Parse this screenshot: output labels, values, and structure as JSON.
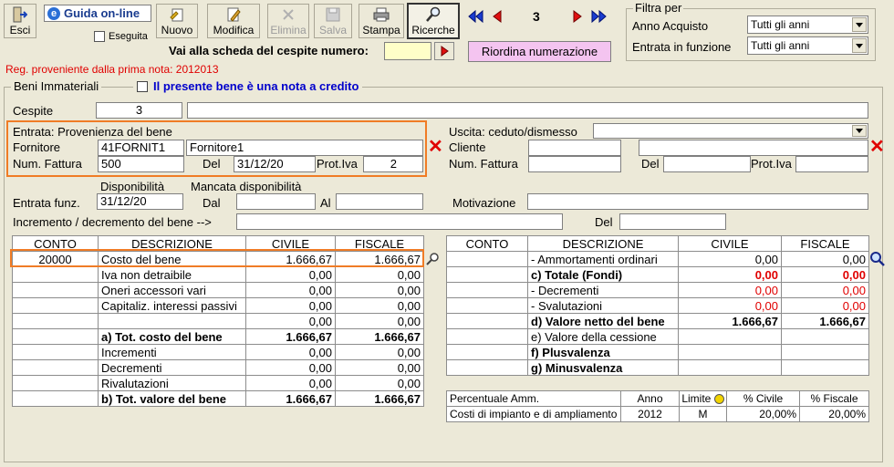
{
  "toolbar": {
    "esci": "Esci",
    "guida": "Guida on-line",
    "eseguita": "Eseguita",
    "nuovo": "Nuovo",
    "modifica": "Modifica",
    "elimina": "Elimina",
    "salva": "Salva",
    "stampa": "Stampa",
    "ricerche": "Ricerche",
    "record_number": "3"
  },
  "vai_label": "Vai alla scheda del cespite numero:",
  "riordina": "Riordina numerazione",
  "filtra": {
    "title": "Filtra per",
    "anno_label": "Anno Acquisto",
    "anno_value": "Tutti gli anni",
    "entrata_label": "Entrata in funzione",
    "entrata_value": "Tutti gli anni"
  },
  "reg_note": "Reg. proveniente dalla prima nota: 2012013",
  "section_title": "Beni Immateriali",
  "nota_credito": "Il presente bene è una nota a credito",
  "cespite": {
    "label": "Cespite",
    "value": "3",
    "desc": ""
  },
  "entrata": {
    "title": "Entrata: Provenienza del bene",
    "fornitore_label": "Fornitore",
    "fornitore_code": "41FORNIT1",
    "fornitore_name": "Fornitore1",
    "num_fattura_label": "Num. Fattura",
    "num_fattura": "500",
    "del_label": "Del",
    "del_value": "31/12/20",
    "prot_label": "Prot.Iva",
    "prot_value": "2"
  },
  "uscita": {
    "title": "Uscita: ceduto/dismesso",
    "cliente_label": "Cliente",
    "num_fattura_label": "Num. Fattura",
    "del_label": "Del",
    "prot_label": "Prot.Iva"
  },
  "disp": {
    "disponibilita": "Disponibilità",
    "mancata": "Mancata disponibilità",
    "entrata_funz_label": "Entrata funz.",
    "entrata_funz": "31/12/20",
    "dal_label": "Dal",
    "al_label": "Al",
    "motivazione_label": "Motivazione",
    "incremento_label": "Incremento / decremento del bene -->",
    "del_label": "Del"
  },
  "left_table": {
    "headers": [
      "CONTO",
      "DESCRIZIONE",
      "CIVILE",
      "FISCALE"
    ],
    "rows": [
      {
        "conto": "20000",
        "desc": "Costo del bene",
        "civile": "1.666,67",
        "fiscale": "1.666,67",
        "bold": false
      },
      {
        "conto": "",
        "desc": "Iva non detraibile",
        "civile": "0,00",
        "fiscale": "0,00",
        "bold": false
      },
      {
        "conto": "",
        "desc": "Oneri accessori vari",
        "civile": "0,00",
        "fiscale": "0,00",
        "bold": false
      },
      {
        "conto": "",
        "desc": "Capitaliz. interessi passivi",
        "civile": "0,00",
        "fiscale": "0,00",
        "bold": false
      },
      {
        "conto": "",
        "desc": "",
        "civile": "0,00",
        "fiscale": "0,00",
        "bold": false
      },
      {
        "conto": "",
        "desc": "a) Tot. costo del bene",
        "civile": "1.666,67",
        "fiscale": "1.666,67",
        "bold": true
      },
      {
        "conto": "",
        "desc": "Incrementi",
        "civile": "0,00",
        "fiscale": "0,00",
        "bold": false
      },
      {
        "conto": "",
        "desc": "Decrementi",
        "civile": "0,00",
        "fiscale": "0,00",
        "bold": false
      },
      {
        "conto": "",
        "desc": "Rivalutazioni",
        "civile": "0,00",
        "fiscale": "0,00",
        "bold": false
      },
      {
        "conto": "",
        "desc": "b) Tot. valore del bene",
        "civile": "1.666,67",
        "fiscale": "1.666,67",
        "bold": true
      }
    ]
  },
  "right_table": {
    "headers": [
      "CONTO",
      "DESCRIZIONE",
      "CIVILE",
      "FISCALE"
    ],
    "rows": [
      {
        "desc": "- Ammortamenti ordinari",
        "civile": "0,00",
        "fiscale": "0,00",
        "style": "normal"
      },
      {
        "desc": "c) Totale (Fondi)",
        "civile": "0,00",
        "fiscale": "0,00",
        "style": "boldred"
      },
      {
        "desc": "- Decrementi",
        "civile": "0,00",
        "fiscale": "0,00",
        "style": "red"
      },
      {
        "desc": "- Svalutazioni",
        "civile": "0,00",
        "fiscale": "0,00",
        "style": "red"
      },
      {
        "desc": "d) Valore netto del bene",
        "civile": "1.666,67",
        "fiscale": "1.666,67",
        "style": "bold"
      },
      {
        "desc": "e) Valore della cessione",
        "civile": "",
        "fiscale": "",
        "style": "normal"
      },
      {
        "desc": "f) Plusvalenza",
        "civile": "",
        "fiscale": "",
        "style": "bold"
      },
      {
        "desc": "g) Minusvalenza",
        "civile": "",
        "fiscale": "",
        "style": "bold"
      }
    ]
  },
  "perc_table": {
    "headers": [
      "Percentuale Amm.",
      "Anno",
      "Limite",
      "% Civile",
      "% Fiscale"
    ],
    "row": {
      "desc": "Costi di impianto e di ampliamento",
      "anno": "2012",
      "limite": "M",
      "civile": "20,00%",
      "fiscale": "20,00%"
    }
  },
  "colors": {
    "accent_orange": "#f07c26",
    "red": "#e00000",
    "blue_text": "#0000cc",
    "pink_button": "#f4c4f0"
  }
}
